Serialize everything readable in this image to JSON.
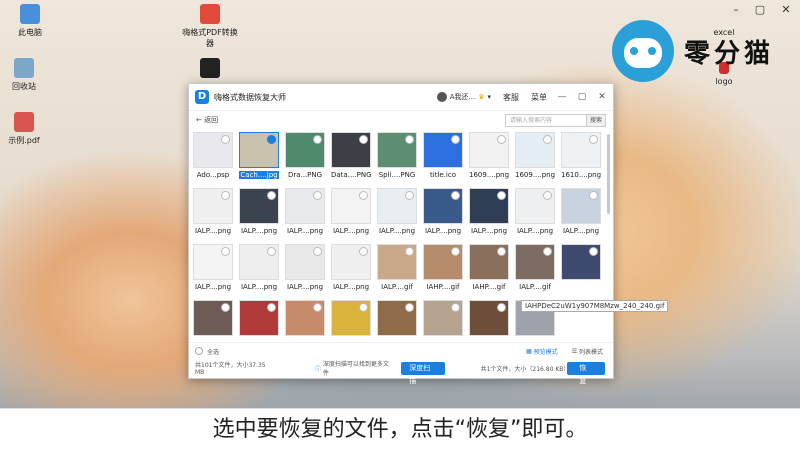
{
  "desktop": {
    "icons": [
      {
        "label": "此电脑",
        "color": "#4a8fd9"
      },
      {
        "label": "回收站",
        "color": "#7ba7c9"
      },
      {
        "label": "示例.pdf",
        "color": "#d9534f"
      },
      {
        "label": "嗨格式PDF转换器",
        "color": "#e24a3b"
      },
      {
        "label": "",
        "color": "#222"
      }
    ],
    "right_icons": [
      {
        "label": "excel"
      },
      {
        "label": "logo"
      }
    ]
  },
  "logo": {
    "text": "零分猫"
  },
  "window_controls": [
    "–",
    "▢",
    "✕"
  ],
  "app": {
    "title": "嗨格式数据恢复大师",
    "user": "A我还...",
    "service": "客服",
    "menu": "菜单",
    "win": [
      "—",
      "▢",
      "✕"
    ],
    "back": "返回",
    "search_placeholder": "请输入搜索内容",
    "search_btn": "搜索",
    "files": [
      {
        "name": "Ado...psp",
        "sel": false,
        "color": "#e8e8ee"
      },
      {
        "name": "Cach....jpg",
        "sel": true,
        "color": "#c9c2ad"
      },
      {
        "name": "Dra...PNG",
        "sel": false,
        "color": "#4e8a6b"
      },
      {
        "name": "Data....PNG",
        "sel": false,
        "color": "#3c3f46"
      },
      {
        "name": "Spli....PNG",
        "sel": false,
        "color": "#5d8e72"
      },
      {
        "name": "title.ico",
        "sel": false,
        "color": "#2e6fe0"
      },
      {
        "name": "1609....png",
        "sel": false,
        "color": "#f2f2f2"
      },
      {
        "name": "1609....png",
        "sel": false,
        "color": "#e6eef5"
      },
      {
        "name": "1610....png",
        "sel": false,
        "color": "#eef2f5"
      },
      {
        "name": "IALP....png",
        "sel": false,
        "color": "#f0f0f0"
      },
      {
        "name": "IALP....png",
        "sel": false,
        "color": "#3b4250"
      },
      {
        "name": "IALP....png",
        "sel": false,
        "color": "#e8eaee"
      },
      {
        "name": "IALP....png",
        "sel": false,
        "color": "#f3f3f3"
      },
      {
        "name": "IALP....png",
        "sel": false,
        "color": "#e9eef3"
      },
      {
        "name": "IALP....png",
        "sel": false,
        "color": "#3a5a8c"
      },
      {
        "name": "IALP....png",
        "sel": false,
        "color": "#2f3e55"
      },
      {
        "name": "IALP....png",
        "sel": false,
        "color": "#eef0f2"
      },
      {
        "name": "IALP....png",
        "sel": false,
        "color": "#c7d3de"
      },
      {
        "name": "IALP....png",
        "sel": false,
        "color": "#f4f4f4"
      },
      {
        "name": "IALP....png",
        "sel": false,
        "color": "#eeeeee"
      },
      {
        "name": "IALP....png",
        "sel": false,
        "color": "#e8e8e8"
      },
      {
        "name": "IALP....png",
        "sel": false,
        "color": "#f0f0f0"
      },
      {
        "name": "IALP....gif",
        "sel": false,
        "color": "#c9a98a"
      },
      {
        "name": "IAHP....gif",
        "sel": false,
        "color": "#b58d6a"
      },
      {
        "name": "IAHP....gif",
        "sel": false,
        "color": "#8a6f5d"
      },
      {
        "name": "IALP....gif",
        "sel": false,
        "color": "#7d6b62"
      },
      {
        "name": "",
        "sel": false,
        "color": "#3e4a6e"
      },
      {
        "name": "",
        "sel": false,
        "color": "#6d5c55"
      },
      {
        "name": "",
        "sel": false,
        "color": "#b03a3a"
      },
      {
        "name": "",
        "sel": false,
        "color": "#c68b6a"
      },
      {
        "name": "",
        "sel": false,
        "color": "#d9b33c"
      },
      {
        "name": "",
        "sel": false,
        "color": "#8f6b4a"
      },
      {
        "name": "",
        "sel": false,
        "color": "#b5a38f"
      },
      {
        "name": "",
        "sel": false,
        "color": "#6e4f3c"
      },
      {
        "name": "",
        "sel": false,
        "color": "#9fa3ab"
      }
    ],
    "tooltip": "IAHPDeC2uW1y907M8Mzw_240_240.gif",
    "select_all": "全选",
    "preview_mode": "预览模式",
    "list_mode": "列表模式",
    "total": "共101个文件，大小37.35 MB",
    "deep_hint": "深度扫描可以找到更多文件",
    "deep_btn": "深度扫描",
    "selected": "共1个文件，大小（216.80 KB）",
    "recover_btn": "恢复"
  },
  "caption": "选中要恢复的文件，点击“恢复”即可。"
}
